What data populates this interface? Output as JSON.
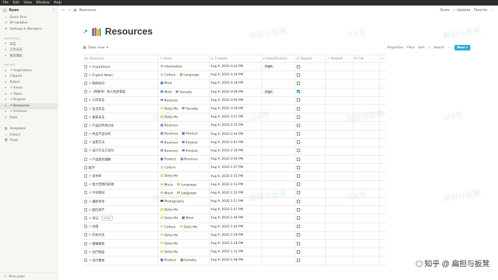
{
  "menubar": [
    "File",
    "Edit",
    "View",
    "Window",
    "Help"
  ],
  "workspace": "Ryan",
  "sidebar": {
    "top_items": [
      {
        "icon": "search-icon",
        "glyph": "⌕",
        "label": "Quick Find"
      },
      {
        "icon": "clock-icon",
        "glyph": "◷",
        "label": "All Updates"
      },
      {
        "icon": "gear-icon",
        "glyph": "⚙",
        "label": "Settings & Members"
      }
    ],
    "favorites_title": "FAVORITES",
    "favorites": [
      {
        "glyph": "▸",
        "label": "日志"
      },
      {
        "glyph": "▸",
        "label": "工作日志"
      },
      {
        "glyph": "▸",
        "label": "我的目标"
      }
    ],
    "private_title": "PRIVATE",
    "private": [
      {
        "glyph": "▸",
        "label": "↗ Inspirations"
      },
      {
        "glyph": "▸",
        "label": "Clipped"
      },
      {
        "glyph": "▸",
        "label": "ToSort"
      },
      {
        "glyph": "▸",
        "label": "↗ Areas"
      },
      {
        "glyph": "▸",
        "label": "↗ Tasks"
      },
      {
        "glyph": "▸",
        "label": "↗ Projects"
      },
      {
        "glyph": "▸",
        "label": "↗ Resources"
      },
      {
        "glyph": "▸",
        "label": "↗ Archives"
      },
      {
        "glyph": "▸",
        "label": "Data"
      }
    ],
    "utilities": [
      {
        "icon": "template-icon",
        "glyph": "▦",
        "label": "Templates"
      },
      {
        "icon": "import-icon",
        "glyph": "⇣",
        "label": "Import"
      },
      {
        "icon": "trash-icon",
        "glyph": "🗑",
        "label": "Trash"
      }
    ],
    "new_page": "New page"
  },
  "topbar": {
    "breadcrumb": "Resources",
    "share": "Share",
    "updates": "✓ Updates",
    "favorite": "Favorite",
    "more": "···"
  },
  "page": {
    "arrow": "↗",
    "title": "Resources"
  },
  "viewbar": {
    "view": "Table view",
    "properties": "Properties",
    "filter": "Filter",
    "sort": "Sort",
    "search": "Search",
    "more": "···",
    "new": "New"
  },
  "columns": [
    "Resource",
    "Areas",
    "Created",
    "Simplification",
    "Regular",
    "Related",
    "File"
  ],
  "tag_colors": {
    "Information": "#a7c4e4",
    "Culture": "#f0c9d6",
    "Language": "#e6a85f",
    "Mind": "#5b8fd1",
    "Socialty": "#b38a6a",
    "Business": "#8f98d6",
    "Daily-life": "#e7d77a",
    "Product": "#6b88c9",
    "Music": "#d7c49e",
    "Photography": "#555555"
  },
  "rows": [
    {
      "resource": "↗ Inspirations",
      "areas": [
        "Information"
      ],
      "created": "Aug 9, 2020 4:24 PM",
      "simplification": "high",
      "regular": false
    },
    {
      "resource": "↗ English News",
      "areas": [
        "Culture",
        "Language"
      ],
      "created": "Aug 9, 2020 4:19 PM",
      "simplification": "",
      "regular": false
    },
    {
      "resource": "↗ 我的知识",
      "areas": [
        "Mind"
      ],
      "created": "Aug 9, 2020 4:18 PM",
      "simplification": "",
      "regular": false
    },
    {
      "resource": "↗（简图书）他人经验借鉴",
      "areas": [
        "Mind",
        "Socialty"
      ],
      "created": "Aug 9, 2020 4:09 PM",
      "simplification": "high",
      "regular": true
    },
    {
      "resource": "↗ 工作日志",
      "areas": [
        "Business"
      ],
      "created": "Aug 9, 2020 4:00 PM",
      "simplification": "",
      "regular": false
    },
    {
      "resource": "↗ 生活日志",
      "areas": [
        "Daily-life",
        "Socialty"
      ],
      "created": "Aug 9, 2020 3:58 PM",
      "simplification": "",
      "regular": false
    },
    {
      "resource": "↗ 家庭日志",
      "areas": [
        "Daily-life"
      ],
      "created": "Aug 9, 2020 3:57 PM",
      "simplification": "",
      "regular": false
    },
    {
      "resource": "↗ 产品的市场讨论",
      "areas": [
        "Business"
      ],
      "created": "Aug 9, 2020 2:55 PM",
      "simplification": "",
      "regular": false
    },
    {
      "resource": "↗ 商业产品分析",
      "areas": [
        "Business",
        "Product"
      ],
      "created": "Aug 9, 2020 2:44 PM",
      "simplification": "",
      "regular": false
    },
    {
      "resource": "↗ 运营方法",
      "areas": [
        "Business",
        "Product"
      ],
      "created": "Aug 9, 2020 2:41 PM",
      "simplification": "",
      "regular": false
    },
    {
      "resource": "↗ 设计方法工具包",
      "areas": [
        "Business",
        "Product"
      ],
      "created": "Aug 9, 2020 2:39 PM",
      "simplification": "",
      "regular": false
    },
    {
      "resource": "↗ 产品类的理解",
      "areas": [
        "Product",
        "Business"
      ],
      "created": "Aug 9, 2020 2:04 PM",
      "simplification": "",
      "regular": false
    },
    {
      "resource": "医学",
      "areas": [
        "Culture"
      ],
      "created": "Aug 9, 2020 1:57 PM",
      "simplification": "",
      "regular": false
    },
    {
      "resource": "↗ 读书单",
      "areas": [
        "Daily-life"
      ],
      "created": "Aug 9, 2020 1:55 PM",
      "simplification": "",
      "regular": false
    },
    {
      "resource": "↗ 能力范围内的歌",
      "areas": [
        "Music",
        "Language"
      ],
      "created": "Aug 9, 2020 1:53 PM",
      "simplification": "",
      "regular": false
    },
    {
      "resource": "↗ 外语歌词",
      "areas": [
        "Music",
        "Language"
      ],
      "created": "Aug 9, 2020 1:52 PM",
      "simplification": "",
      "regular": false
    },
    {
      "resource": "↗ 摄影参考",
      "areas": [
        "Photography"
      ],
      "created": "Aug 9, 2020 1:51 PM",
      "simplification": "",
      "regular": false
    },
    {
      "resource": "↗ 面包资产",
      "areas": [
        "Daily-life"
      ],
      "created": "Aug 9, 2020 1:47 PM",
      "simplification": "",
      "regular": false
    },
    {
      "resource": "↗ 日记",
      "areas": [
        "Daily-life",
        "Mind"
      ],
      "created": "Aug 9, 2020 1:46 PM",
      "simplification": "",
      "regular": false,
      "open": "OPEN"
    },
    {
      "resource": "↗ 动漫",
      "areas": [
        "Culture",
        "Daily-life"
      ],
      "created": "Aug 9, 2020 1:40 PM",
      "simplification": "",
      "regular": false
    },
    {
      "resource": "↗ 饮食文化",
      "areas": [
        "Daily-life"
      ],
      "created": "Aug 9, 2020 1:29 PM",
      "simplification": "",
      "regular": false
    },
    {
      "resource": "↗ 健康教程",
      "areas": [
        "Daily-life"
      ],
      "created": "Aug 9, 2020 1:28 PM",
      "simplification": "",
      "regular": false
    },
    {
      "resource": "↗ 出行物品",
      "areas": [
        "Daily-life"
      ],
      "created": "Aug 9, 2020 1:12 PM",
      "simplification": "",
      "regular": false
    },
    {
      "resource": "↗ 设计模式",
      "areas": [
        "Product",
        "Socialty"
      ],
      "created": "Aug 9, 2020 1:08 PM",
      "simplification": "",
      "regular": false
    }
  ],
  "watermarks": [
    "扁担与扳凳",
    "以6号"
  ],
  "brand": "知乎 @ 扁担与扳凳"
}
